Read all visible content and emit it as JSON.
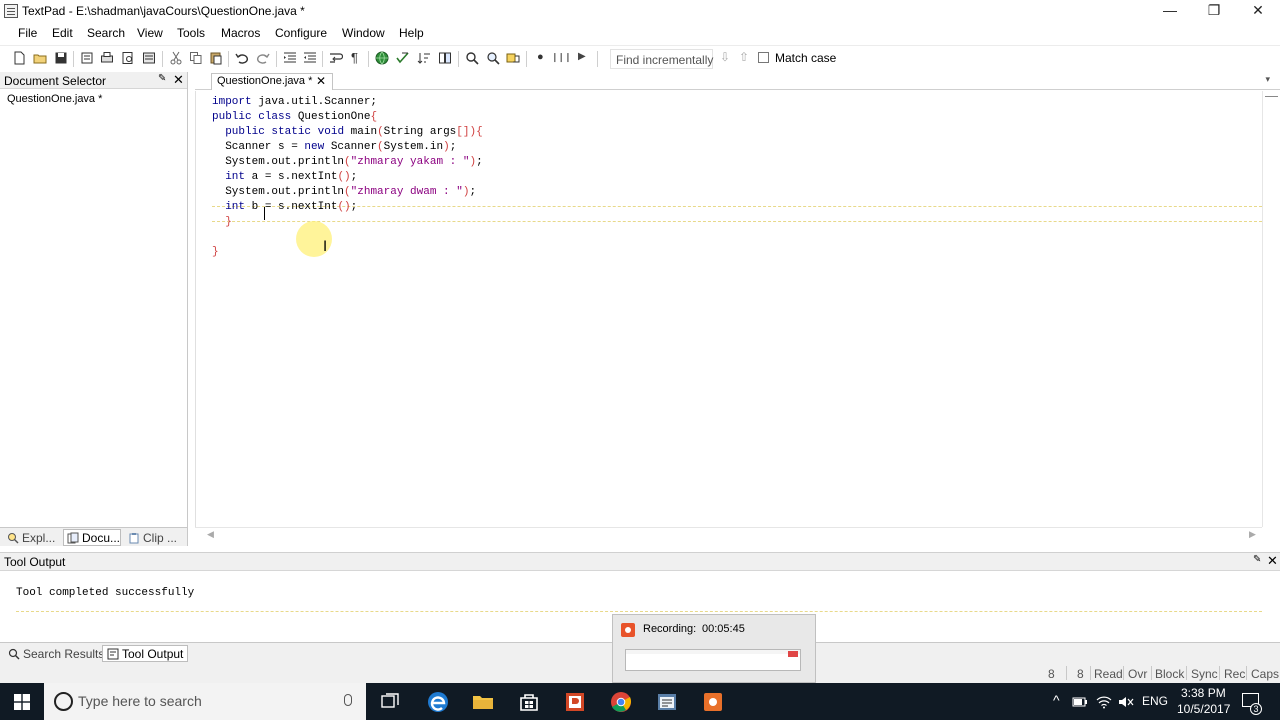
{
  "window": {
    "title": "TextPad - E:\\shadman\\javaCours\\QuestionOne.java *",
    "controls": {
      "minimize": "—",
      "restore": "❐",
      "close": "✕"
    }
  },
  "menu": [
    "File",
    "Edit",
    "Search",
    "View",
    "Tools",
    "Macros",
    "Configure",
    "Window",
    "Help"
  ],
  "toolbar": {
    "find_placeholder": "Find incrementally",
    "match_case_label": "Match case",
    "match_case_checked": false
  },
  "document_selector": {
    "title": "Document Selector",
    "pin": "📌",
    "close": "✕",
    "files": [
      "QuestionOne.java *"
    ],
    "tabs": [
      {
        "label": "Expl...",
        "icon": "explorer-icon"
      },
      {
        "label": "Docu...",
        "icon": "documents-icon",
        "active": true
      },
      {
        "label": "Clip ...",
        "icon": "clip-library-icon"
      }
    ]
  },
  "editor": {
    "tab_label": "QuestionOne.java *",
    "tab_close": "✕",
    "lines": [
      "import java.util.Scanner;",
      "public class QuestionOne{",
      "  public static void main(String args[]){",
      "  Scanner s = new Scanner(System.in);",
      "  System.out.println(\"zhmaray yakam : \");",
      "  int a = s.nextInt();",
      "  System.out.println(\"zhmaray dwam : \");",
      "  int b = s.nextInt();",
      "  }",
      "",
      "}"
    ],
    "cursor_line": 8
  },
  "tool_output": {
    "title": "Tool Output",
    "message": "Tool completed successfully",
    "tabs": [
      {
        "label": "Search Results",
        "icon": "search-results-icon"
      },
      {
        "label": "Tool Output",
        "icon": "tool-output-icon",
        "active": true
      }
    ]
  },
  "statusbar": {
    "line": "8",
    "column": "8",
    "flags": [
      "Read",
      "Ovr",
      "Block",
      "Sync",
      "Rec",
      "Caps"
    ]
  },
  "recording": {
    "label": "Recording:",
    "time": "00:05:45"
  },
  "taskbar": {
    "search_placeholder": "Type here to search",
    "language": "ENG",
    "time": "3:38 PM",
    "date": "10/5/2017",
    "notification_count": "3"
  },
  "colors": {
    "keyword": "#00008b",
    "string": "#8b0080",
    "brace": "#d04040",
    "taskbar": "#101a24",
    "accent": "#76b9ed"
  }
}
